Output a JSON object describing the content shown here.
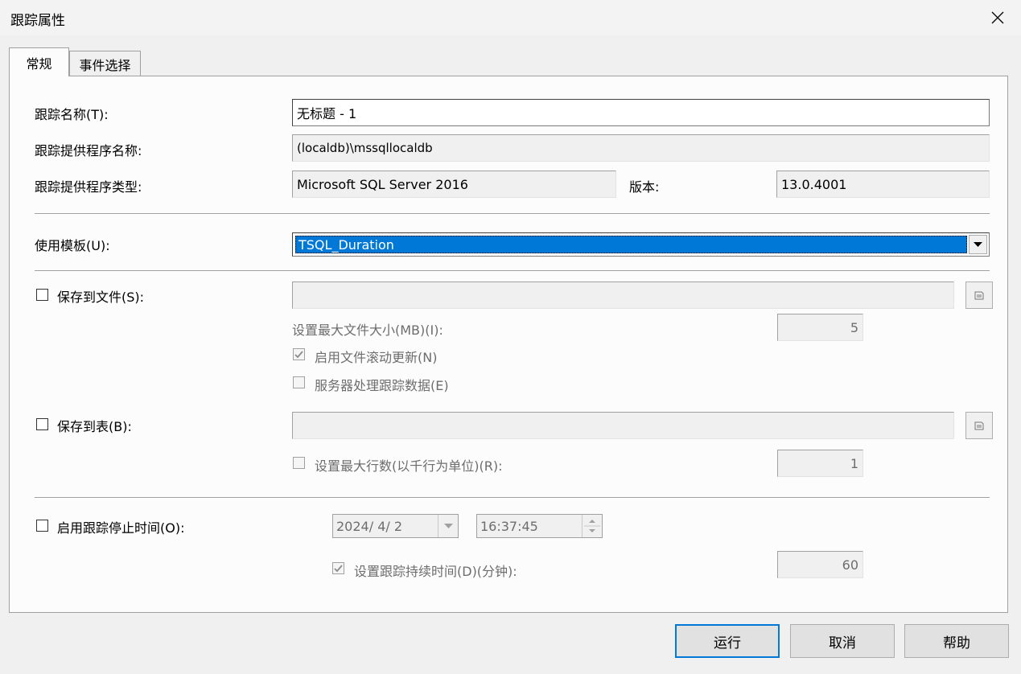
{
  "window": {
    "title": "跟踪属性"
  },
  "tabs": [
    {
      "label": "常规"
    },
    {
      "label": "事件选择"
    }
  ],
  "general": {
    "trace_name_label": "跟踪名称(T):",
    "trace_name_value": "无标题 - 1",
    "provider_name_label": "跟踪提供程序名称:",
    "provider_name_value": "(localdb)\\mssqllocaldb",
    "provider_type_label": "跟踪提供程序类型:",
    "provider_type_value": "Microsoft SQL Server 2016",
    "version_label": "版本:",
    "version_value": "13.0.4001",
    "template_label": "使用模板(U):",
    "template_value": "TSQL_Duration"
  },
  "save_file": {
    "label": "保存到文件(S):",
    "checked": false,
    "path": "",
    "max_size_label": "设置最大文件大小(MB)(I):",
    "max_size_value": "5",
    "rollover_label": "启用文件滚动更新(N)",
    "rollover_checked": true,
    "server_process_label": "服务器处理跟踪数据(E)",
    "server_process_checked": false
  },
  "save_table": {
    "label": "保存到表(B):",
    "checked": false,
    "path": "",
    "max_rows_label": "设置最大行数(以千行为单位)(R):",
    "max_rows_checked": false,
    "max_rows_value": "1"
  },
  "stop_time": {
    "label": "启用跟踪停止时间(O):",
    "checked": false,
    "date": "2024/ 4/ 2",
    "time": "16:37:45",
    "duration_label": "设置跟踪持续时间(D)(分钟):",
    "duration_checked": true,
    "duration_value": "60"
  },
  "buttons": {
    "run": "运行",
    "cancel": "取消",
    "help": "帮助"
  }
}
